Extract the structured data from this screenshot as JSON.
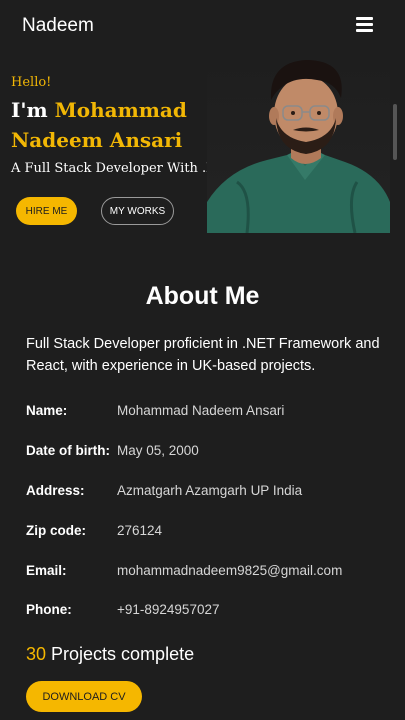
{
  "navbar": {
    "brand": "Nadeem",
    "menu_icon": "hamburger-menu-icon"
  },
  "hero": {
    "greeting": "Hello!",
    "intro_prefix": "I'm ",
    "name_first": "Mohammad",
    "name_last": "Nadeem Ansari",
    "tagline": "A Full Stack Developer With .Net",
    "hire_button": "HIRE ME",
    "works_button": "MY WORKS",
    "photo_icon": "profile-photo"
  },
  "about": {
    "title": "About Me",
    "description": "Full Stack Developer proficient in .NET Framework and React, with experience in UK-based projects.",
    "details": [
      {
        "label": "Name:",
        "value": "Mohammad Nadeem Ansari"
      },
      {
        "label": "Date of birth:",
        "value": "May 05, 2000"
      },
      {
        "label": "Address:",
        "value": "Azmatgarh Azamgarh UP India"
      },
      {
        "label": "Zip code:",
        "value": "276124"
      },
      {
        "label": "Email:",
        "value": "mohammadnadeem9825@gmail.com"
      },
      {
        "label": "Phone:",
        "value": "+91-8924957027"
      }
    ],
    "projects_count": "30",
    "projects_label": " Projects complete",
    "download_button": "DOWNLOAD CV"
  },
  "colors": {
    "accent": "#f5b700",
    "background": "#1e1e1e",
    "text": "#ffffff"
  }
}
